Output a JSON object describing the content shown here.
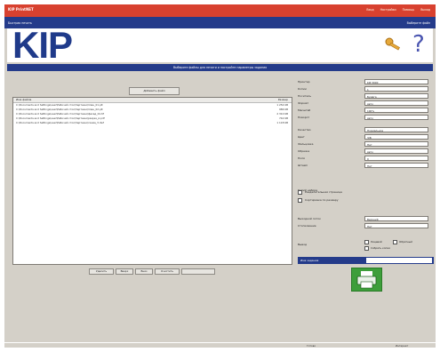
{
  "app": {
    "title": "KIP PrintNET",
    "top_links": [
      "Вход",
      "Настройки",
      "Помощь",
      "Выход"
    ],
    "sub_left": "Быстрая печать",
    "sub_right": "Выберите файл"
  },
  "logo": {
    "text": "KIP"
  },
  "band": {
    "text": "Выберите файлы для печати и настройте параметры задания"
  },
  "upload_button": "Добавить файл",
  "file_list": {
    "headers": [
      "Имя файла",
      "Размер"
    ],
    "rows": [
      {
        "path": "C:\\Documents and Settings\\user\\Рабочий стол\\Чертежи\\план_01.plt",
        "size": "1 254 KB"
      },
      {
        "path": "C:\\Documents and Settings\\user\\Рабочий стол\\Чертежи\\план_02.plt",
        "size": "986 KB"
      },
      {
        "path": "C:\\Documents and Settings\\user\\Рабочий стол\\Чертежи\\фасад_01.tif",
        "size": "2 310 KB"
      },
      {
        "path": "C:\\Documents and Settings\\user\\Рабочий стол\\Чертежи\\разрез_A.pdf",
        "size": "742 KB"
      },
      {
        "path": "C:\\Documents and Settings\\user\\Рабочий стол\\Чертежи\\схема_3.dwf",
        "size": "1 118 KB"
      }
    ]
  },
  "pager": [
    "Удалить",
    "Вверх",
    "Вниз",
    "Очистить"
  ],
  "options": [
    {
      "label": "Принтер",
      "value": "KIP 3000"
    },
    {
      "label": "Копии",
      "value": "1"
    },
    {
      "label": "Носитель",
      "value": "Бумага"
    },
    {
      "label": "Формат",
      "value": "Авто"
    },
    {
      "label": "Масштаб",
      "value": "100%"
    },
    {
      "label": "Поворот",
      "value": "Авто"
    },
    {
      "label": "Качество",
      "value": "Нормальное"
    },
    {
      "label": "Цвет",
      "value": "Ч/Б"
    },
    {
      "label": "Фальцовка",
      "value": "Нет"
    },
    {
      "label": "Обрезка",
      "value": "Авто"
    },
    {
      "label": "Поля",
      "value": "0"
    },
    {
      "label": "Штамп",
      "value": "Нет"
    }
  ],
  "copies_label": "Копий набора",
  "checkbox_a": "Разделительная страница",
  "checkbox_b": "Сортировка по размеру",
  "finishing": [
    {
      "label": "Выходной лоток",
      "value": "Верхний"
    },
    {
      "label": "Стопкование",
      "value": "Нет"
    }
  ],
  "output_label": "Вывод",
  "output_checks": [
    "Лицевой",
    "Обратный",
    "Собрать копии"
  ],
  "job_name_label": "Имя задания",
  "taskbar": {
    "left": "Готово",
    "right": "Интернет"
  }
}
